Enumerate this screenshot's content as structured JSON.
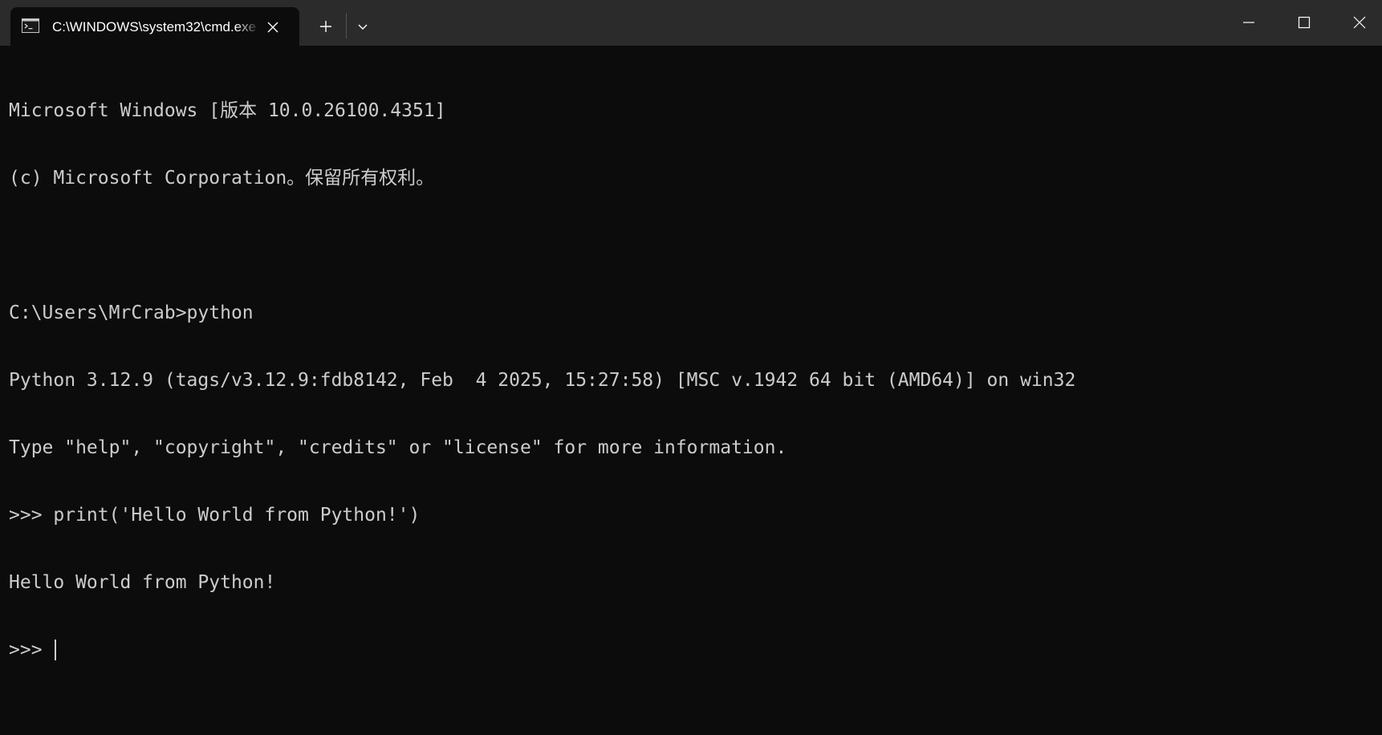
{
  "tab": {
    "title": "C:\\WINDOWS\\system32\\cmd.exe",
    "icon": "cmd-icon"
  },
  "titlebar_buttons": {
    "close_tab_icon": "close-icon",
    "new_tab_icon": "plus-icon",
    "dropdown_icon": "chevron-down-icon",
    "minimize_icon": "minimize-icon",
    "maximize_icon": "maximize-icon",
    "close_window_icon": "close-icon"
  },
  "terminal": {
    "lines": [
      "Microsoft Windows [版本 10.0.26100.4351]",
      "(c) Microsoft Corporation。保留所有权利。",
      "",
      "C:\\Users\\MrCrab>python",
      "Python 3.12.9 (tags/v3.12.9:fdb8142, Feb  4 2025, 15:27:58) [MSC v.1942 64 bit (AMD64)] on win32",
      "Type \"help\", \"copyright\", \"credits\" or \"license\" for more information.",
      ">>> print('Hello World from Python!')",
      "Hello World from Python!"
    ],
    "prompt": ">>> "
  },
  "colors": {
    "background": "#0c0c0c",
    "titlebar": "#2b2b2b",
    "text": "#cccccc"
  }
}
